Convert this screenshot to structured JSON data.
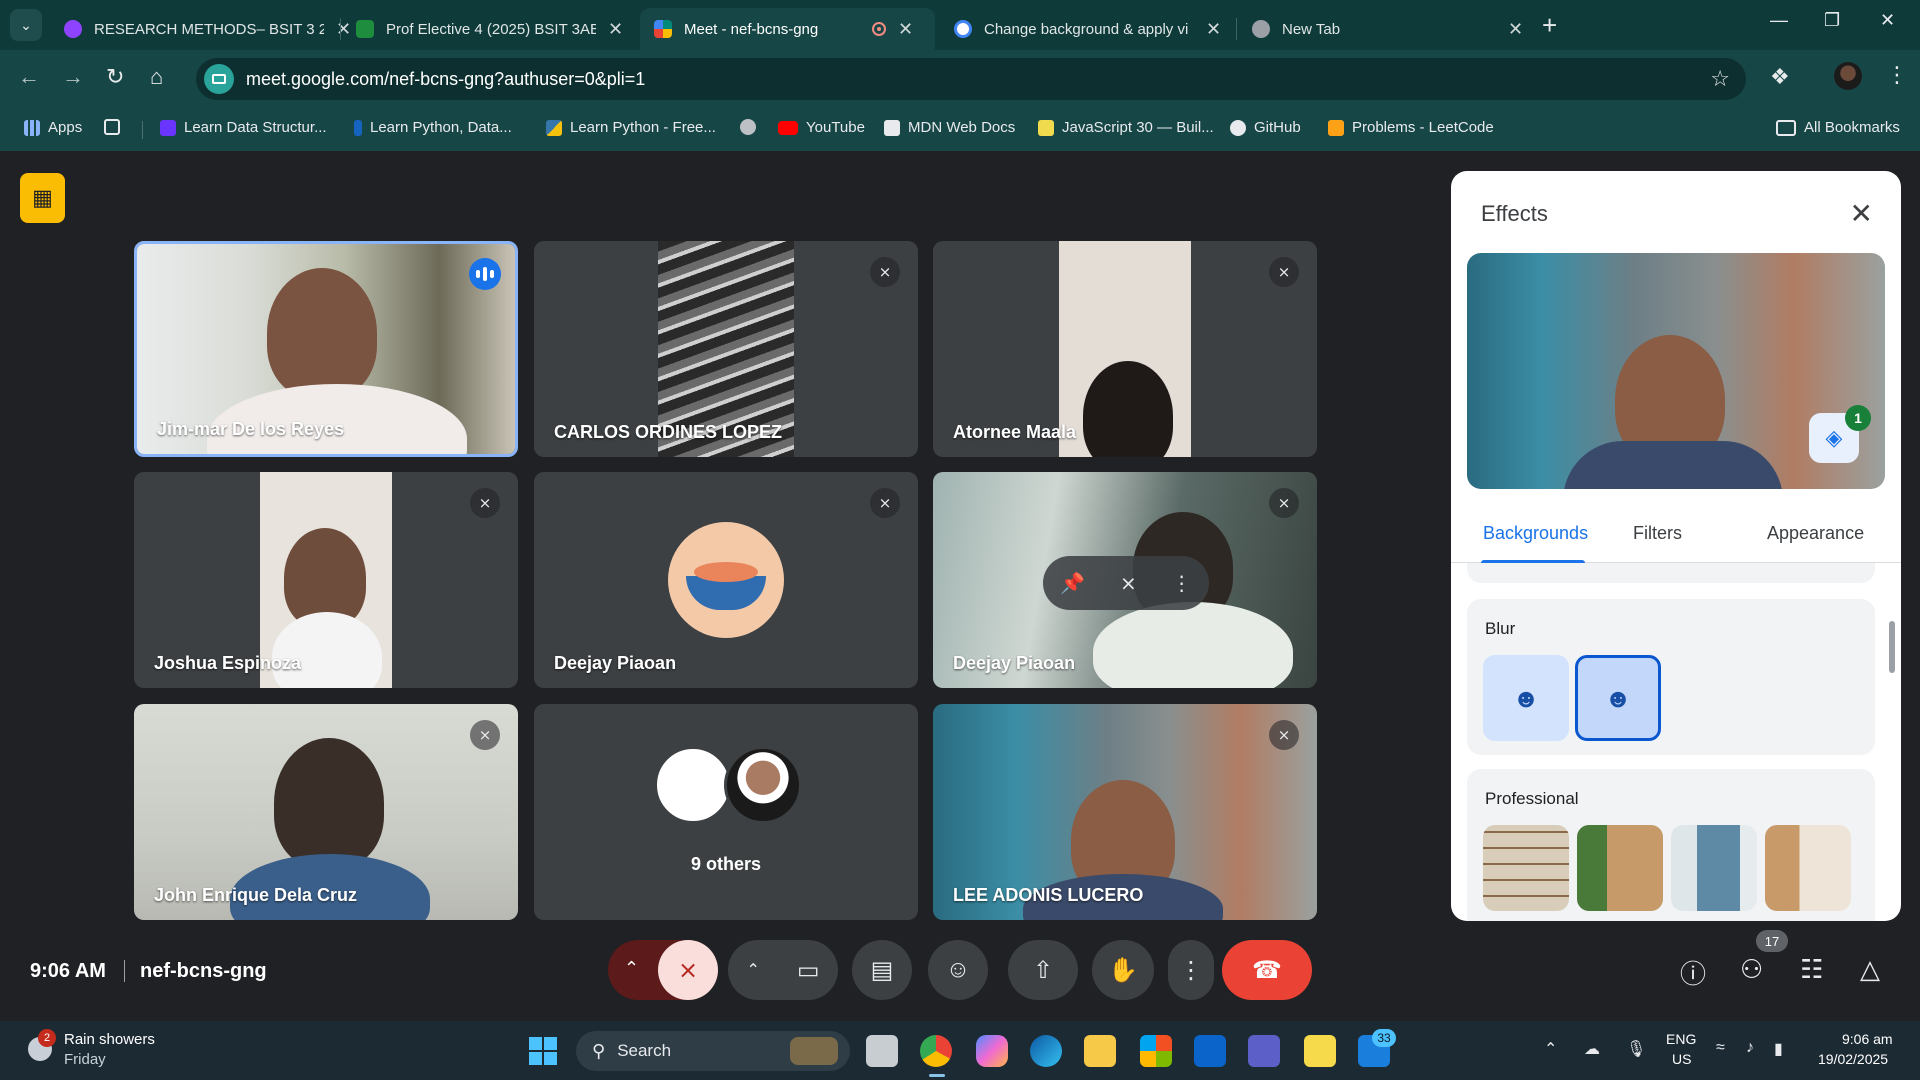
{
  "browser": {
    "tabs": [
      {
        "title": "RESEARCH METHODS– BSIT 3 2",
        "favicon_color": "#8e44ff"
      },
      {
        "title": "Prof Elective 4 (2025) BSIT 3AB",
        "favicon_color": "#1e8e3e"
      },
      {
        "title": "Meet - nef-bcns-gng",
        "favicon_color": "#00897b"
      },
      {
        "title": "Change background & apply vi",
        "favicon_color": "#4285f4"
      },
      {
        "title": "New Tab",
        "favicon_color": "#9aa0a6"
      }
    ],
    "url": "meet.google.com/nef-bcns-gng?authuser=0&pli=1",
    "bookmarks": [
      {
        "label": "Apps",
        "color": "#4285f4"
      },
      {
        "label": "Learn Data Structur...",
        "color": "#6a35ff"
      },
      {
        "label": "Learn Python, Data...",
        "color": "#1565c0"
      },
      {
        "label": "Learn Python - Free...",
        "color": "#f4c20d"
      },
      {
        "label": "YouTube",
        "color": "#ff0000"
      },
      {
        "label": "MDN Web Docs",
        "color": "#ffffff"
      },
      {
        "label": "JavaScript 30 — Buil...",
        "color": "#f0db4f"
      },
      {
        "label": "GitHub",
        "color": "#ffffff"
      },
      {
        "label": "Problems - LeetCode",
        "color": "#ffa116"
      }
    ],
    "all_bookmarks": "All Bookmarks"
  },
  "meet": {
    "participants": [
      {
        "name": "Jim-mar De los Reyes",
        "speaking": true
      },
      {
        "name": "CARLOS ORDINES LOPEZ",
        "muted": true
      },
      {
        "name": "Atornee Maala",
        "muted": true
      },
      {
        "name": "Joshua Espinoza",
        "muted": true
      },
      {
        "name": "Deejay Piaoan",
        "muted": true
      },
      {
        "name": "Deejay Piaoan",
        "muted": true
      },
      {
        "name": "John Enrique Dela Cruz",
        "muted": true
      },
      {
        "name": "9 others"
      },
      {
        "name": "LEE ADONIS LUCERO",
        "muted": true
      }
    ],
    "time": "9:06 AM",
    "meeting_code": "nef-bcns-gng",
    "people_count": "17"
  },
  "effects": {
    "title": "Effects",
    "layers_count": "1",
    "tabs": [
      "Backgrounds",
      "Filters",
      "Appearance"
    ],
    "active_tab": "Backgrounds",
    "blur_heading": "Blur",
    "professional_heading": "Professional"
  },
  "taskbar": {
    "weather_title": "Rain showers",
    "weather_day": "Friday",
    "weather_badge": "2",
    "search_placeholder": "Search",
    "teams_badge": "33",
    "lang_line1": "ENG",
    "lang_line2": "US",
    "clock_time": "9:06 am",
    "clock_date": "19/02/2025"
  }
}
